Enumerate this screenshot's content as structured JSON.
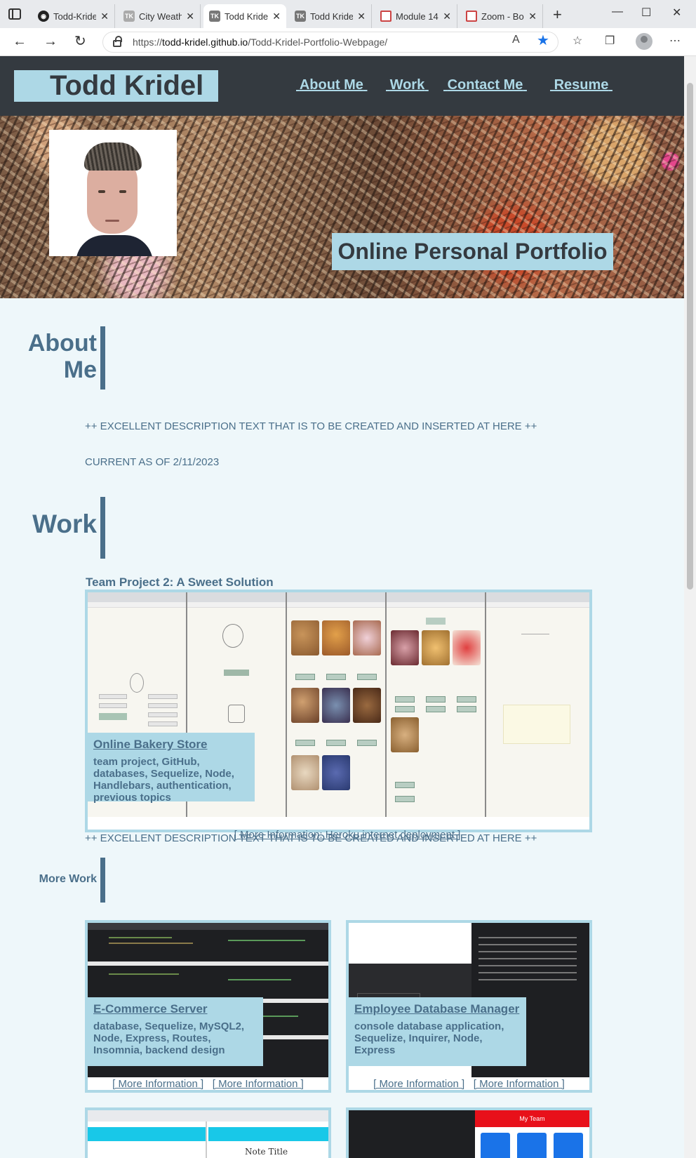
{
  "browser": {
    "tabs": [
      {
        "title": "Todd-Kridel",
        "favicon": "github-icon"
      },
      {
        "title": "City Weath",
        "favicon": "tk-icon"
      },
      {
        "title": "Todd Kride",
        "favicon": "tk-icon"
      },
      {
        "title": "Todd Kride",
        "favicon": "tk-icon"
      },
      {
        "title": "Module 14",
        "favicon": "bcs-icon"
      },
      {
        "title": "Zoom - Bo",
        "favicon": "bcs-icon"
      }
    ],
    "url_prefix": "https://",
    "url_domain": "todd-kridel.github.io",
    "url_path": "/Todd-Kridel-Portfolio-Webpage/"
  },
  "header": {
    "name": "Todd Kridel",
    "nav": [
      "About Me",
      "Work",
      "Contact Me",
      "Resume"
    ]
  },
  "hero": {
    "tagline": "Online Personal Portfolio"
  },
  "about": {
    "heading_line1": "About",
    "heading_line2": "Me",
    "description": "++ EXCELLENT DESCRIPTION TEXT THAT IS TO BE CREATED AND INSERTED AT HERE ++",
    "current_as_of": "CURRENT AS OF 2/11/2023"
  },
  "work": {
    "heading": "Work",
    "featured": {
      "project_title": "Team Project 2: A Sweet Solution",
      "card_title": "Online Bakery Store",
      "tags": "team project, GitHub, databases, Sequelize, Node, Handlebars, authentication, previous topics",
      "link": "[ More Information: Heroku internet deployment ]",
      "description": "++ EXCELLENT DESCRIPTION TEXT THAT IS TO BE CREATED AND INSERTED AT HERE ++"
    },
    "more_heading": "More Work",
    "projects": [
      {
        "title": "E-Commerce Server",
        "tags": "database, Sequelize, MySQL2, Node, Express, Routes, Insomnia, backend design",
        "link1": "[ More Information ]",
        "link2": "[ More Information ]"
      },
      {
        "title": "Employee Database Manager",
        "tags": "console database application, Sequelize, Inquirer, Node, Express",
        "link1": "[ More Information ]",
        "link2": "[ More Information ]"
      }
    ],
    "partial_cards": {
      "note_title": "Note Title",
      "team_title": "My Team"
    }
  },
  "colors": {
    "header_bg": "#343a40",
    "accent": "#add8e6",
    "text": "#4a6f8a",
    "page_bg": "#eef7fa"
  }
}
